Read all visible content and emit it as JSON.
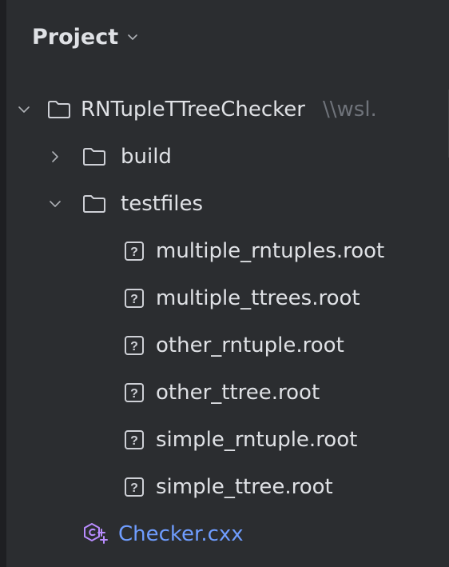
{
  "panel": {
    "title": "Project"
  },
  "tree": {
    "root": {
      "label": "RNTupleTTreeChecker",
      "path_hint": "\\\\wsl."
    },
    "build": {
      "label": "build"
    },
    "testfiles": {
      "label": "testfiles"
    },
    "files": [
      {
        "label": "multiple_rntuples.root"
      },
      {
        "label": "multiple_ttrees.root"
      },
      {
        "label": "other_rntuple.root"
      },
      {
        "label": "other_ttree.root"
      },
      {
        "label": "simple_rntuple.root"
      },
      {
        "label": "simple_ttree.root"
      }
    ],
    "cpp_file": {
      "label": "Checker.cxx"
    }
  },
  "colors": {
    "background": "#2b2d30",
    "text": "#dfe1e5",
    "muted": "#6f737a",
    "cpp_accent": "#6f9dff",
    "cpp_icon": "#b98cff"
  }
}
